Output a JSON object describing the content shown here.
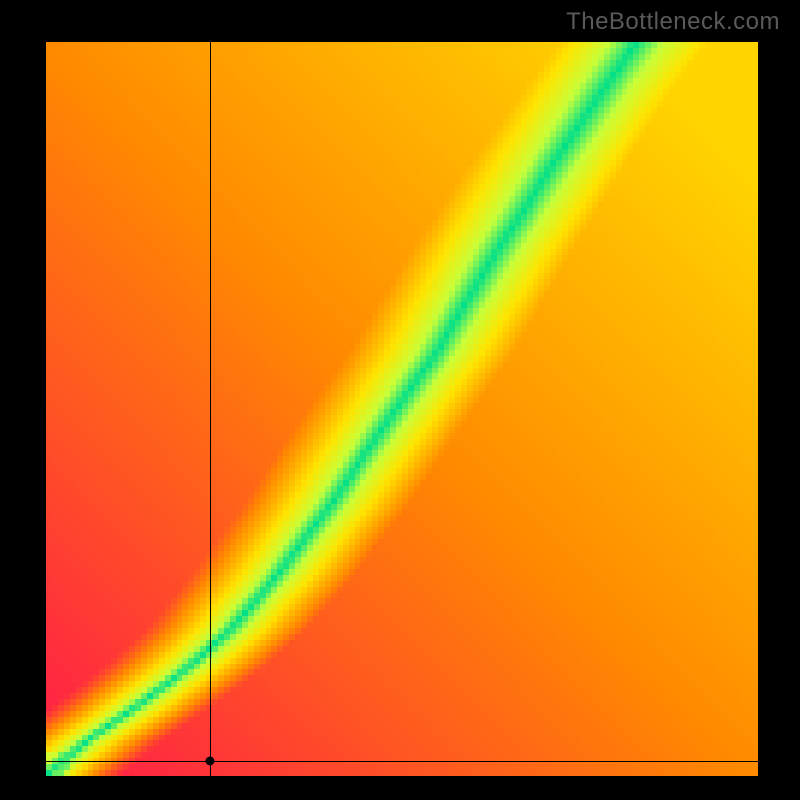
{
  "watermark": "TheBottleneck.com",
  "chart_data": {
    "type": "heatmap",
    "title": "",
    "xlabel": "",
    "ylabel": "",
    "xlim": [
      0,
      1
    ],
    "ylim": [
      0,
      1
    ],
    "colors": {
      "low": "#ff1a4b",
      "mid_warm": "#ff8a00",
      "mid": "#ffe400",
      "mid_cool": "#c8ff3a",
      "high": "#00e08a"
    },
    "ridge_path": [
      {
        "x": 0.0,
        "y": 0.0
      },
      {
        "x": 0.06,
        "y": 0.05
      },
      {
        "x": 0.12,
        "y": 0.09
      },
      {
        "x": 0.19,
        "y": 0.14
      },
      {
        "x": 0.26,
        "y": 0.2
      },
      {
        "x": 0.33,
        "y": 0.28
      },
      {
        "x": 0.4,
        "y": 0.37
      },
      {
        "x": 0.47,
        "y": 0.47
      },
      {
        "x": 0.55,
        "y": 0.58
      },
      {
        "x": 0.63,
        "y": 0.71
      },
      {
        "x": 0.73,
        "y": 0.86
      },
      {
        "x": 0.8,
        "y": 0.96
      },
      {
        "x": 0.83,
        "y": 1.0
      }
    ],
    "ridge_width": 0.06,
    "crosshair": {
      "x": 0.23,
      "y": 0.02
    },
    "grid": false,
    "legend": false,
    "resolution": {
      "w": 120,
      "h": 124
    }
  }
}
